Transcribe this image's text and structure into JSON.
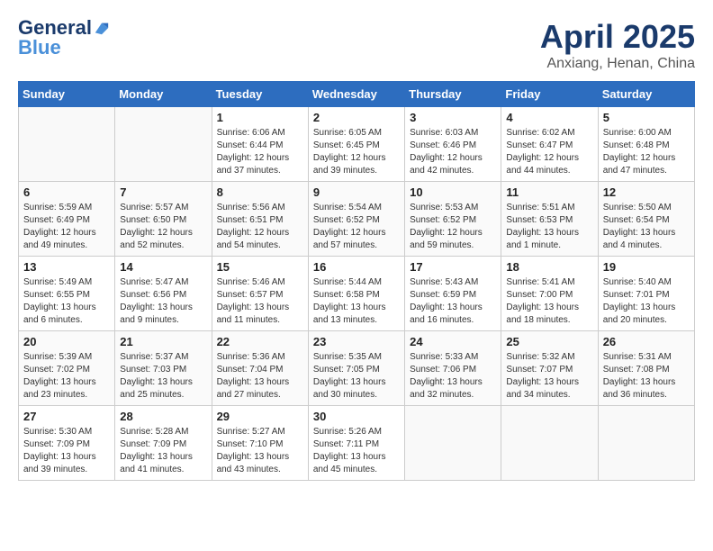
{
  "header": {
    "logo_line1": "General",
    "logo_line2": "Blue",
    "month_title": "April 2025",
    "location": "Anxiang, Henan, China"
  },
  "days_of_week": [
    "Sunday",
    "Monday",
    "Tuesday",
    "Wednesday",
    "Thursday",
    "Friday",
    "Saturday"
  ],
  "weeks": [
    [
      {
        "day": "",
        "sunrise": "",
        "sunset": "",
        "daylight": ""
      },
      {
        "day": "",
        "sunrise": "",
        "sunset": "",
        "daylight": ""
      },
      {
        "day": "1",
        "sunrise": "Sunrise: 6:06 AM",
        "sunset": "Sunset: 6:44 PM",
        "daylight": "Daylight: 12 hours and 37 minutes."
      },
      {
        "day": "2",
        "sunrise": "Sunrise: 6:05 AM",
        "sunset": "Sunset: 6:45 PM",
        "daylight": "Daylight: 12 hours and 39 minutes."
      },
      {
        "day": "3",
        "sunrise": "Sunrise: 6:03 AM",
        "sunset": "Sunset: 6:46 PM",
        "daylight": "Daylight: 12 hours and 42 minutes."
      },
      {
        "day": "4",
        "sunrise": "Sunrise: 6:02 AM",
        "sunset": "Sunset: 6:47 PM",
        "daylight": "Daylight: 12 hours and 44 minutes."
      },
      {
        "day": "5",
        "sunrise": "Sunrise: 6:00 AM",
        "sunset": "Sunset: 6:48 PM",
        "daylight": "Daylight: 12 hours and 47 minutes."
      }
    ],
    [
      {
        "day": "6",
        "sunrise": "Sunrise: 5:59 AM",
        "sunset": "Sunset: 6:49 PM",
        "daylight": "Daylight: 12 hours and 49 minutes."
      },
      {
        "day": "7",
        "sunrise": "Sunrise: 5:57 AM",
        "sunset": "Sunset: 6:50 PM",
        "daylight": "Daylight: 12 hours and 52 minutes."
      },
      {
        "day": "8",
        "sunrise": "Sunrise: 5:56 AM",
        "sunset": "Sunset: 6:51 PM",
        "daylight": "Daylight: 12 hours and 54 minutes."
      },
      {
        "day": "9",
        "sunrise": "Sunrise: 5:54 AM",
        "sunset": "Sunset: 6:52 PM",
        "daylight": "Daylight: 12 hours and 57 minutes."
      },
      {
        "day": "10",
        "sunrise": "Sunrise: 5:53 AM",
        "sunset": "Sunset: 6:52 PM",
        "daylight": "Daylight: 12 hours and 59 minutes."
      },
      {
        "day": "11",
        "sunrise": "Sunrise: 5:51 AM",
        "sunset": "Sunset: 6:53 PM",
        "daylight": "Daylight: 13 hours and 1 minute."
      },
      {
        "day": "12",
        "sunrise": "Sunrise: 5:50 AM",
        "sunset": "Sunset: 6:54 PM",
        "daylight": "Daylight: 13 hours and 4 minutes."
      }
    ],
    [
      {
        "day": "13",
        "sunrise": "Sunrise: 5:49 AM",
        "sunset": "Sunset: 6:55 PM",
        "daylight": "Daylight: 13 hours and 6 minutes."
      },
      {
        "day": "14",
        "sunrise": "Sunrise: 5:47 AM",
        "sunset": "Sunset: 6:56 PM",
        "daylight": "Daylight: 13 hours and 9 minutes."
      },
      {
        "day": "15",
        "sunrise": "Sunrise: 5:46 AM",
        "sunset": "Sunset: 6:57 PM",
        "daylight": "Daylight: 13 hours and 11 minutes."
      },
      {
        "day": "16",
        "sunrise": "Sunrise: 5:44 AM",
        "sunset": "Sunset: 6:58 PM",
        "daylight": "Daylight: 13 hours and 13 minutes."
      },
      {
        "day": "17",
        "sunrise": "Sunrise: 5:43 AM",
        "sunset": "Sunset: 6:59 PM",
        "daylight": "Daylight: 13 hours and 16 minutes."
      },
      {
        "day": "18",
        "sunrise": "Sunrise: 5:41 AM",
        "sunset": "Sunset: 7:00 PM",
        "daylight": "Daylight: 13 hours and 18 minutes."
      },
      {
        "day": "19",
        "sunrise": "Sunrise: 5:40 AM",
        "sunset": "Sunset: 7:01 PM",
        "daylight": "Daylight: 13 hours and 20 minutes."
      }
    ],
    [
      {
        "day": "20",
        "sunrise": "Sunrise: 5:39 AM",
        "sunset": "Sunset: 7:02 PM",
        "daylight": "Daylight: 13 hours and 23 minutes."
      },
      {
        "day": "21",
        "sunrise": "Sunrise: 5:37 AM",
        "sunset": "Sunset: 7:03 PM",
        "daylight": "Daylight: 13 hours and 25 minutes."
      },
      {
        "day": "22",
        "sunrise": "Sunrise: 5:36 AM",
        "sunset": "Sunset: 7:04 PM",
        "daylight": "Daylight: 13 hours and 27 minutes."
      },
      {
        "day": "23",
        "sunrise": "Sunrise: 5:35 AM",
        "sunset": "Sunset: 7:05 PM",
        "daylight": "Daylight: 13 hours and 30 minutes."
      },
      {
        "day": "24",
        "sunrise": "Sunrise: 5:33 AM",
        "sunset": "Sunset: 7:06 PM",
        "daylight": "Daylight: 13 hours and 32 minutes."
      },
      {
        "day": "25",
        "sunrise": "Sunrise: 5:32 AM",
        "sunset": "Sunset: 7:07 PM",
        "daylight": "Daylight: 13 hours and 34 minutes."
      },
      {
        "day": "26",
        "sunrise": "Sunrise: 5:31 AM",
        "sunset": "Sunset: 7:08 PM",
        "daylight": "Daylight: 13 hours and 36 minutes."
      }
    ],
    [
      {
        "day": "27",
        "sunrise": "Sunrise: 5:30 AM",
        "sunset": "Sunset: 7:09 PM",
        "daylight": "Daylight: 13 hours and 39 minutes."
      },
      {
        "day": "28",
        "sunrise": "Sunrise: 5:28 AM",
        "sunset": "Sunset: 7:09 PM",
        "daylight": "Daylight: 13 hours and 41 minutes."
      },
      {
        "day": "29",
        "sunrise": "Sunrise: 5:27 AM",
        "sunset": "Sunset: 7:10 PM",
        "daylight": "Daylight: 13 hours and 43 minutes."
      },
      {
        "day": "30",
        "sunrise": "Sunrise: 5:26 AM",
        "sunset": "Sunset: 7:11 PM",
        "daylight": "Daylight: 13 hours and 45 minutes."
      },
      {
        "day": "",
        "sunrise": "",
        "sunset": "",
        "daylight": ""
      },
      {
        "day": "",
        "sunrise": "",
        "sunset": "",
        "daylight": ""
      },
      {
        "day": "",
        "sunrise": "",
        "sunset": "",
        "daylight": ""
      }
    ]
  ]
}
